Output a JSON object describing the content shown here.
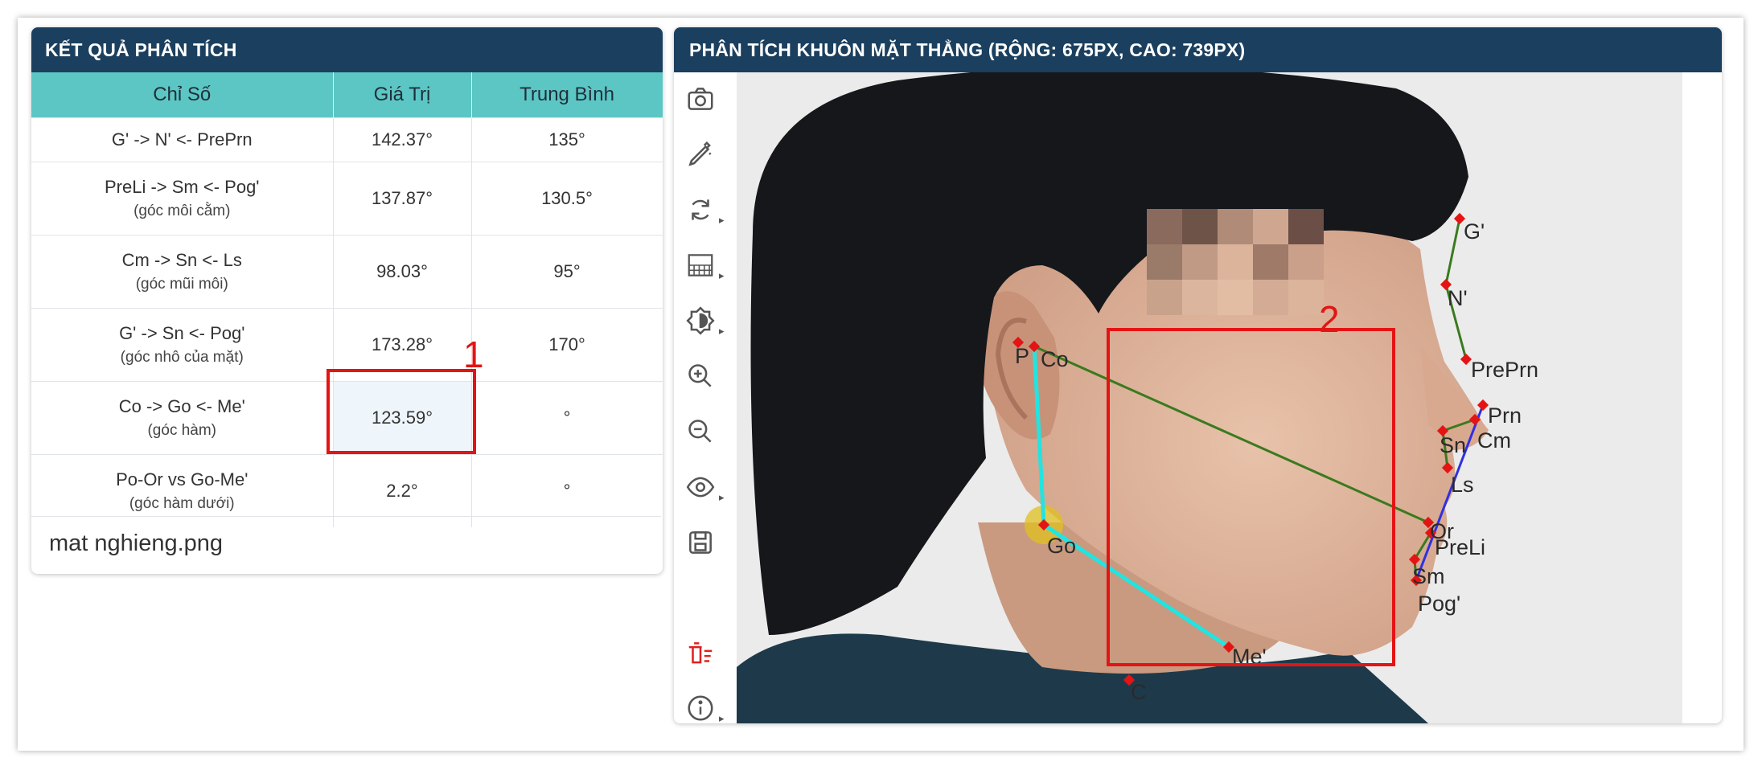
{
  "left_panel": {
    "title": "KẾT QUẢ PHÂN TÍCH",
    "columns": [
      "Chỉ Số",
      "Giá Trị",
      "Trung Bình"
    ],
    "rows": [
      {
        "index": "G' -> N' <- PrePrn",
        "note": "",
        "value": "142.37°",
        "mean": "135°"
      },
      {
        "index": "PreLi -> Sm <- Pog'",
        "note": "(góc môi cằm)",
        "value": "137.87°",
        "mean": "130.5°"
      },
      {
        "index": "Cm -> Sn <- Ls",
        "note": "(góc mũi môi)",
        "value": "98.03°",
        "mean": "95°"
      },
      {
        "index": "G' -> Sn <- Pog'",
        "note": "(góc nhô của mặt)",
        "value": "173.28°",
        "mean": "170°"
      },
      {
        "index": "Co -> Go <- Me'",
        "note": "(góc hàm)",
        "value": "123.59°",
        "mean": "°"
      },
      {
        "index": "Po-Or vs Go-Me'",
        "note": "(góc hàm dưới)",
        "value": "2.2°",
        "mean": "°"
      }
    ],
    "filename": "mat nghieng.png"
  },
  "right_panel": {
    "title": "PHÂN TÍCH KHUÔN MẶT THẲNG (RỘNG: 675PX, CAO: 739PX)",
    "tools": [
      "camera-icon",
      "pen-icon",
      "rotate-icon",
      "pattern-icon",
      "contrast-icon",
      "zoom-in-icon",
      "zoom-out-icon",
      "eye-icon",
      "save-icon",
      "clear-icon",
      "info-icon"
    ]
  },
  "landmarks": {
    "g": "G'",
    "n": "N'",
    "preprn": "PrePrn",
    "prn": "Prn",
    "sn": "Sn",
    "cm": "Cm",
    "ls": "Ls",
    "or": "Or",
    "preli": "PreLi",
    "sm": "Sm",
    "pog": "Pog'",
    "me": "Me'",
    "c": "C",
    "co": "Co",
    "go": "Go",
    "po": "P"
  },
  "annotations": {
    "one": "1",
    "two": "2"
  },
  "colors": {
    "header": "#1b3f5e",
    "table_header": "#5cc6c4",
    "highlight": "#e41414",
    "line_green": "#3a7a1e",
    "line_cyan": "#22e4e0",
    "line_blue": "#3030e0",
    "point": "#e41414"
  }
}
